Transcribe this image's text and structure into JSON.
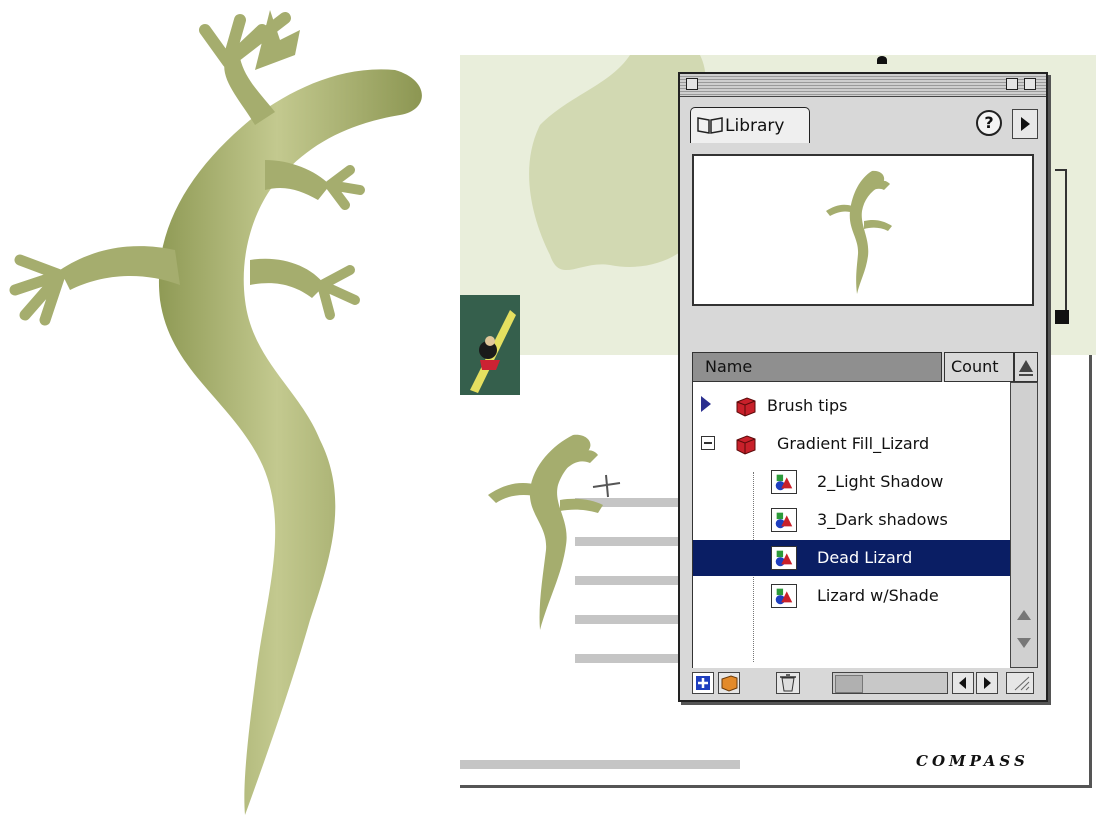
{
  "library": {
    "tab_label": "Library",
    "help_label": "?",
    "columns": {
      "name": "Name",
      "count": "Count"
    },
    "items": [
      {
        "label": "Brush tips",
        "kind": "folder",
        "state": "collapsed"
      },
      {
        "label": "Gradient Fill_Lizard",
        "kind": "folder",
        "state": "expanded"
      },
      {
        "label": "2_Light Shadow",
        "kind": "symbol"
      },
      {
        "label": "3_Dark shadows",
        "kind": "symbol"
      },
      {
        "label": "Dead Lizard",
        "kind": "symbol",
        "selected": true
      },
      {
        "label": "Lizard w/Shade",
        "kind": "symbol"
      }
    ]
  },
  "document": {
    "logo_text": "COMPASS"
  },
  "colors": {
    "lizard": "#a5ad6e",
    "selection": "#0a1e64",
    "map": "#e9eedb"
  }
}
